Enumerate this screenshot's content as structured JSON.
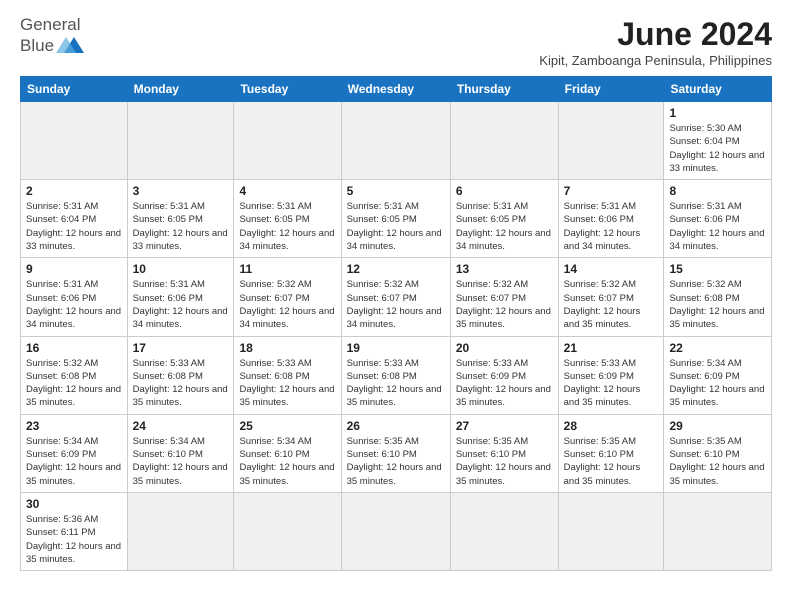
{
  "header": {
    "logo_general": "General",
    "logo_blue": "Blue",
    "month_title": "June 2024",
    "location": "Kipit, Zamboanga Peninsula, Philippines"
  },
  "weekdays": [
    "Sunday",
    "Monday",
    "Tuesday",
    "Wednesday",
    "Thursday",
    "Friday",
    "Saturday"
  ],
  "weeks": [
    [
      {
        "day": "",
        "info": "",
        "empty": true
      },
      {
        "day": "",
        "info": "",
        "empty": true
      },
      {
        "day": "",
        "info": "",
        "empty": true
      },
      {
        "day": "",
        "info": "",
        "empty": true
      },
      {
        "day": "",
        "info": "",
        "empty": true
      },
      {
        "day": "",
        "info": "",
        "empty": true
      },
      {
        "day": "1",
        "info": "Sunrise: 5:30 AM\nSunset: 6:04 PM\nDaylight: 12 hours and 33 minutes."
      }
    ],
    [
      {
        "day": "2",
        "info": "Sunrise: 5:31 AM\nSunset: 6:04 PM\nDaylight: 12 hours and 33 minutes."
      },
      {
        "day": "3",
        "info": "Sunrise: 5:31 AM\nSunset: 6:05 PM\nDaylight: 12 hours and 33 minutes."
      },
      {
        "day": "4",
        "info": "Sunrise: 5:31 AM\nSunset: 6:05 PM\nDaylight: 12 hours and 34 minutes."
      },
      {
        "day": "5",
        "info": "Sunrise: 5:31 AM\nSunset: 6:05 PM\nDaylight: 12 hours and 34 minutes."
      },
      {
        "day": "6",
        "info": "Sunrise: 5:31 AM\nSunset: 6:05 PM\nDaylight: 12 hours and 34 minutes."
      },
      {
        "day": "7",
        "info": "Sunrise: 5:31 AM\nSunset: 6:06 PM\nDaylight: 12 hours and 34 minutes."
      },
      {
        "day": "8",
        "info": "Sunrise: 5:31 AM\nSunset: 6:06 PM\nDaylight: 12 hours and 34 minutes."
      }
    ],
    [
      {
        "day": "9",
        "info": "Sunrise: 5:31 AM\nSunset: 6:06 PM\nDaylight: 12 hours and 34 minutes."
      },
      {
        "day": "10",
        "info": "Sunrise: 5:31 AM\nSunset: 6:06 PM\nDaylight: 12 hours and 34 minutes."
      },
      {
        "day": "11",
        "info": "Sunrise: 5:32 AM\nSunset: 6:07 PM\nDaylight: 12 hours and 34 minutes."
      },
      {
        "day": "12",
        "info": "Sunrise: 5:32 AM\nSunset: 6:07 PM\nDaylight: 12 hours and 34 minutes."
      },
      {
        "day": "13",
        "info": "Sunrise: 5:32 AM\nSunset: 6:07 PM\nDaylight: 12 hours and 35 minutes."
      },
      {
        "day": "14",
        "info": "Sunrise: 5:32 AM\nSunset: 6:07 PM\nDaylight: 12 hours and 35 minutes."
      },
      {
        "day": "15",
        "info": "Sunrise: 5:32 AM\nSunset: 6:08 PM\nDaylight: 12 hours and 35 minutes."
      }
    ],
    [
      {
        "day": "16",
        "info": "Sunrise: 5:32 AM\nSunset: 6:08 PM\nDaylight: 12 hours and 35 minutes."
      },
      {
        "day": "17",
        "info": "Sunrise: 5:33 AM\nSunset: 6:08 PM\nDaylight: 12 hours and 35 minutes."
      },
      {
        "day": "18",
        "info": "Sunrise: 5:33 AM\nSunset: 6:08 PM\nDaylight: 12 hours and 35 minutes."
      },
      {
        "day": "19",
        "info": "Sunrise: 5:33 AM\nSunset: 6:08 PM\nDaylight: 12 hours and 35 minutes."
      },
      {
        "day": "20",
        "info": "Sunrise: 5:33 AM\nSunset: 6:09 PM\nDaylight: 12 hours and 35 minutes."
      },
      {
        "day": "21",
        "info": "Sunrise: 5:33 AM\nSunset: 6:09 PM\nDaylight: 12 hours and 35 minutes."
      },
      {
        "day": "22",
        "info": "Sunrise: 5:34 AM\nSunset: 6:09 PM\nDaylight: 12 hours and 35 minutes."
      }
    ],
    [
      {
        "day": "23",
        "info": "Sunrise: 5:34 AM\nSunset: 6:09 PM\nDaylight: 12 hours and 35 minutes."
      },
      {
        "day": "24",
        "info": "Sunrise: 5:34 AM\nSunset: 6:10 PM\nDaylight: 12 hours and 35 minutes."
      },
      {
        "day": "25",
        "info": "Sunrise: 5:34 AM\nSunset: 6:10 PM\nDaylight: 12 hours and 35 minutes."
      },
      {
        "day": "26",
        "info": "Sunrise: 5:35 AM\nSunset: 6:10 PM\nDaylight: 12 hours and 35 minutes."
      },
      {
        "day": "27",
        "info": "Sunrise: 5:35 AM\nSunset: 6:10 PM\nDaylight: 12 hours and 35 minutes."
      },
      {
        "day": "28",
        "info": "Sunrise: 5:35 AM\nSunset: 6:10 PM\nDaylight: 12 hours and 35 minutes."
      },
      {
        "day": "29",
        "info": "Sunrise: 5:35 AM\nSunset: 6:10 PM\nDaylight: 12 hours and 35 minutes."
      }
    ],
    [
      {
        "day": "30",
        "info": "Sunrise: 5:36 AM\nSunset: 6:11 PM\nDaylight: 12 hours and 35 minutes."
      },
      {
        "day": "",
        "info": "",
        "empty": true
      },
      {
        "day": "",
        "info": "",
        "empty": true
      },
      {
        "day": "",
        "info": "",
        "empty": true
      },
      {
        "day": "",
        "info": "",
        "empty": true
      },
      {
        "day": "",
        "info": "",
        "empty": true
      },
      {
        "day": "",
        "info": "",
        "empty": true
      }
    ]
  ]
}
